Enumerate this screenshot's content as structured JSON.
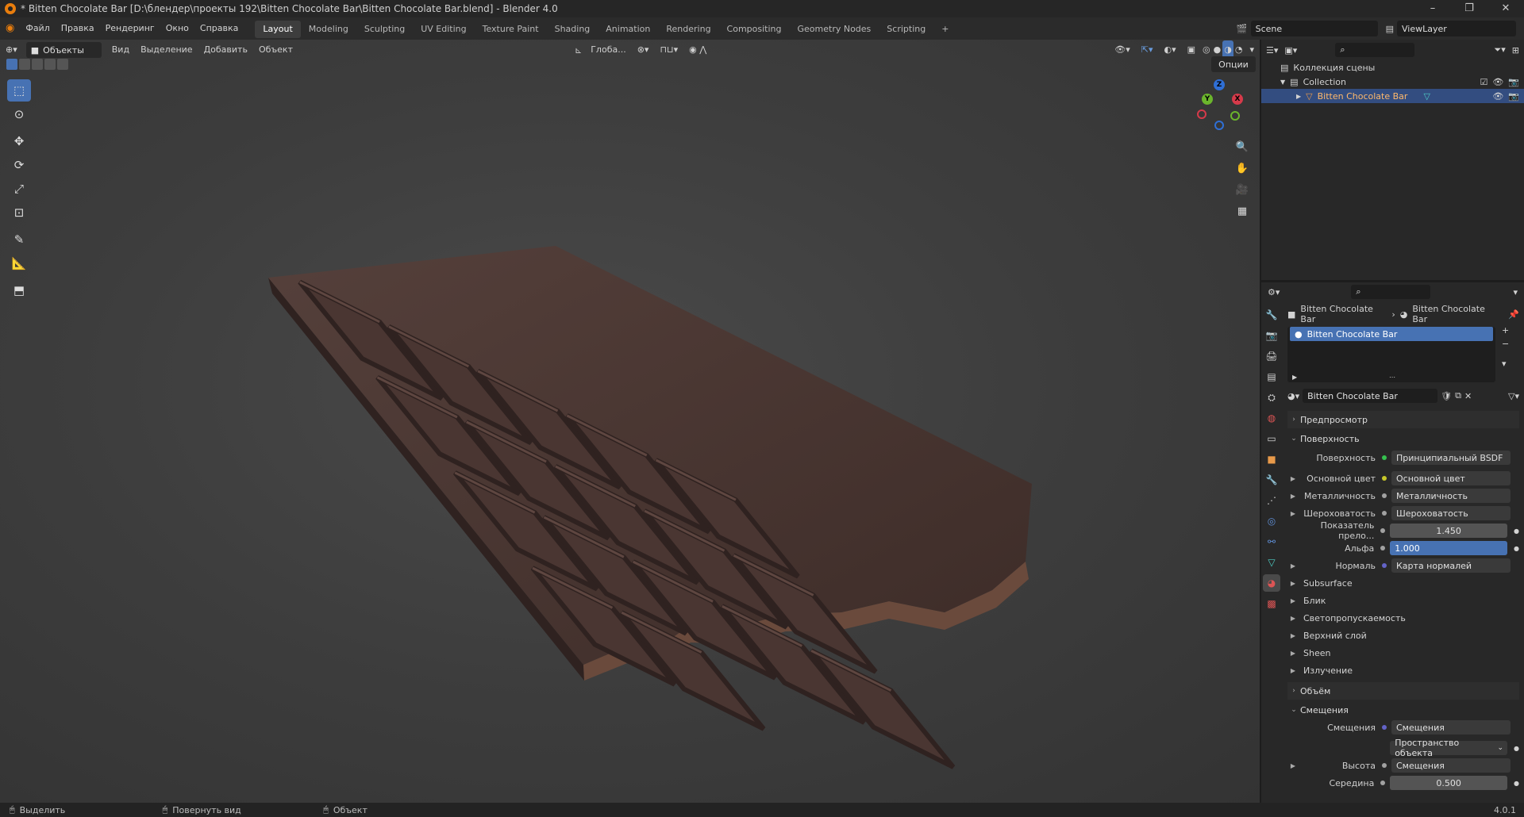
{
  "window": {
    "title": "* Bitten Chocolate Bar [D:\\блендер\\проекты 192\\Bitten Chocolate Bar\\Bitten Chocolate Bar.blend] - Blender 4.0",
    "controls": [
      "–",
      "❐",
      "✕"
    ]
  },
  "menu": {
    "items": [
      "Файл",
      "Правка",
      "Рендеринг",
      "Окно",
      "Справка"
    ],
    "workspaces": [
      "Layout",
      "Modeling",
      "Sculpting",
      "UV Editing",
      "Texture Paint",
      "Shading",
      "Animation",
      "Rendering",
      "Compositing",
      "Geometry Nodes",
      "Scripting"
    ],
    "active_workspace": "Layout",
    "add_tab": "+",
    "scene": "Scene",
    "view_layer": "ViewLayer"
  },
  "viewport": {
    "mode": "Объекты",
    "menus": [
      "Вид",
      "Выделение",
      "Добавить",
      "Объект"
    ],
    "transform_orientation": "Глоба...",
    "options": "Опции",
    "gizmo_axes": [
      "X",
      "Y",
      "Z"
    ]
  },
  "outliner": {
    "scene_collection": "Коллекция сцены",
    "collection": "Collection",
    "object": "Bitten Chocolate Bar"
  },
  "properties": {
    "breadcrumb": [
      "Bitten Chocolate Bar",
      "Bitten Chocolate Bar"
    ],
    "slot": "Bitten Chocolate Bar",
    "material_name": "Bitten Chocolate Bar",
    "sections": {
      "preview": "Предпросмотр",
      "surface": "Поверхность",
      "volume": "Объём",
      "displacement": "Смещения"
    },
    "surface_rows": [
      {
        "label": "Поверхность",
        "value": "Принципиальный BSDF",
        "dot": "#35c14f",
        "kind": "field",
        "expand": false
      },
      {
        "label": "Основной цвет",
        "value": "Основной цвет",
        "dot": "#c7c729",
        "kind": "field",
        "expand": true
      },
      {
        "label": "Металличность",
        "value": "Металличность",
        "dot": "#a1a1a1",
        "kind": "field",
        "expand": true
      },
      {
        "label": "Шероховатость",
        "value": "Шероховатость",
        "dot": "#a1a1a1",
        "kind": "field",
        "expand": true
      },
      {
        "label": "Показатель прело...",
        "value": "1.450",
        "dot": "#a1a1a1",
        "kind": "num",
        "expand": false
      },
      {
        "label": "Альфа",
        "value": "1.000",
        "dot": "#a1a1a1",
        "kind": "blue",
        "expand": false
      },
      {
        "label": "Нормаль",
        "value": "Карта нормалей",
        "dot": "#6363c7",
        "kind": "field",
        "expand": true
      }
    ],
    "subpanels": [
      "Subsurface",
      "Блик",
      "Светопропускаемость",
      "Верхний слой",
      "Sheen",
      "Излучение"
    ],
    "displacement_rows": [
      {
        "label": "Смещения",
        "value": "Смещения",
        "dot": "#6363c7",
        "kind": "field",
        "expand": false
      },
      {
        "label": "",
        "value": "Пространство объекта",
        "dot": "",
        "kind": "select",
        "expand": false
      },
      {
        "label": "Высота",
        "value": "Смещения",
        "dot": "#a1a1a1",
        "kind": "field",
        "expand": true
      },
      {
        "label": "Середина",
        "value": "0.500",
        "dot": "#a1a1a1",
        "kind": "num",
        "expand": false
      }
    ]
  },
  "status": {
    "select": "Выделить",
    "rotate": "Повернуть вид",
    "object": "Объект",
    "version": "4.0.1"
  },
  "colors": {
    "accent": "#4772b3",
    "chocolate": "#4a3632",
    "chocolate_light": "#5e4640",
    "chocolate_dark": "#2f2220"
  }
}
